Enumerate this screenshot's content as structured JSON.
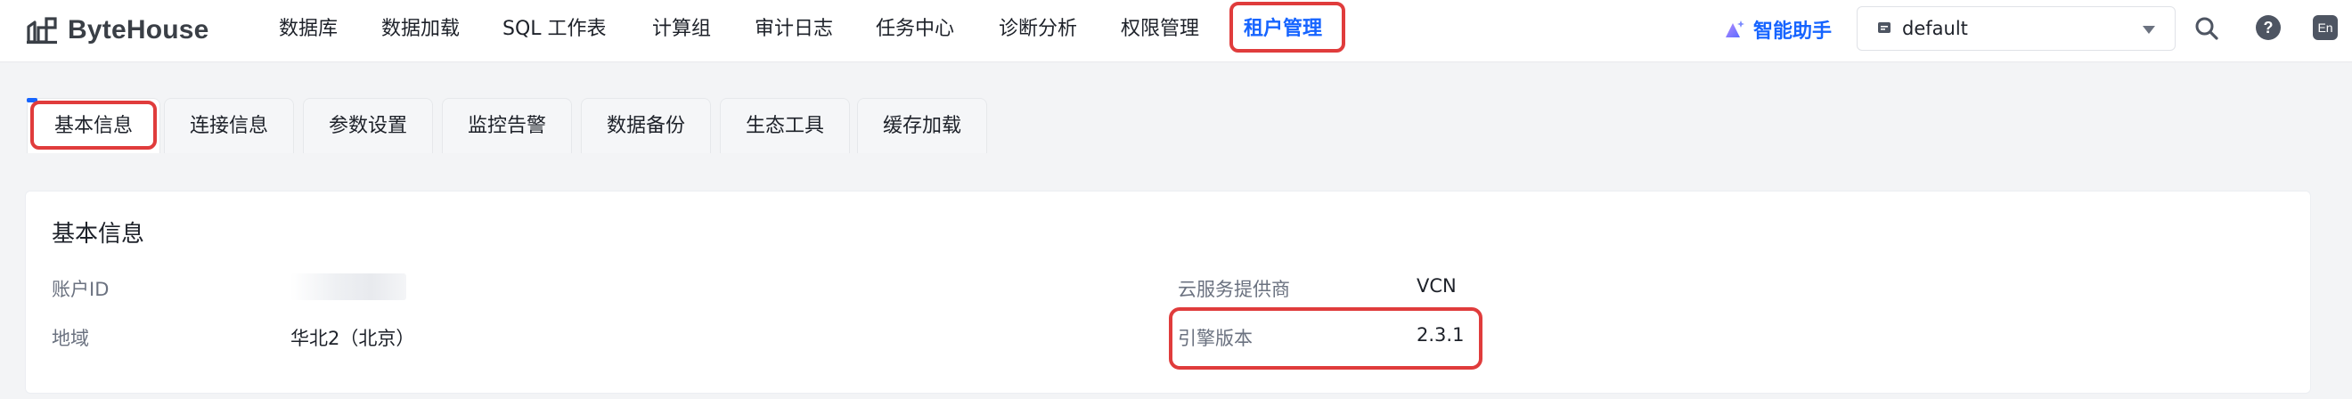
{
  "app": {
    "name": "ByteHouse"
  },
  "nav": {
    "items": [
      {
        "label": "数据库"
      },
      {
        "label": "数据加载"
      },
      {
        "label": "SQL 工作表"
      },
      {
        "label": "计算组"
      },
      {
        "label": "审计日志"
      },
      {
        "label": "任务中心"
      },
      {
        "label": "诊断分析"
      },
      {
        "label": "权限管理"
      },
      {
        "label": "租户管理",
        "active": true
      }
    ],
    "assistant_label": "智能助手",
    "workspace": {
      "selected": "default"
    },
    "lang_label": "En",
    "help_label": "?"
  },
  "tabs": [
    {
      "label": "基本信息",
      "active": true
    },
    {
      "label": "连接信息"
    },
    {
      "label": "参数设置"
    },
    {
      "label": "监控告警"
    },
    {
      "label": "数据备份"
    },
    {
      "label": "生态工具"
    },
    {
      "label": "缓存加载"
    }
  ],
  "basic_info": {
    "title": "基本信息",
    "left": [
      {
        "label": "账户ID",
        "value": ""
      },
      {
        "label": "地域",
        "value": "华北2（北京）"
      }
    ],
    "right": [
      {
        "label": "云服务提供商",
        "value": "VCN"
      },
      {
        "label": "引擎版本",
        "value": "2.3.1"
      }
    ]
  },
  "colors": {
    "accent": "#1664ff",
    "highlight_box": "#e03c3c",
    "background": "#f3f4f6"
  },
  "icons": {
    "logo": "bytehouse-logo-icon",
    "assistant": "sparkle-hat-icon",
    "workspace": "workspace-icon",
    "search": "search-icon",
    "help": "help-icon",
    "language": "language-icon"
  }
}
